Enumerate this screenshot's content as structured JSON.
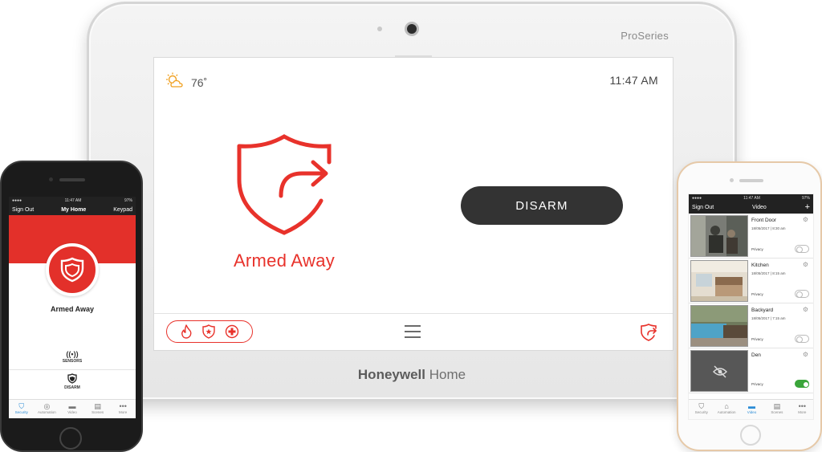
{
  "tablet": {
    "brand_model": "ProSeries",
    "brand_bold": "Honeywell",
    "brand_light": " Home",
    "weather": {
      "icon": "partly-cloudy-icon",
      "temp": "76˚"
    },
    "clock": "11:47 AM",
    "status_label": "Armed Away",
    "disarm_label": "DISARM",
    "emergency_icons": [
      "fire-icon",
      "police-badge-icon",
      "medical-cross-icon"
    ],
    "accent_color": "#e8322b",
    "button_color": "#333333"
  },
  "phone_left": {
    "status_time": "11:47 AM",
    "status_battery": "97%",
    "nav": {
      "left": "Sign Out",
      "title": "My Home",
      "right": "Keypad"
    },
    "status_label": "Armed Away",
    "sensors_label": "SENSORS",
    "disarm_label": "DISARM",
    "tabs": [
      {
        "label": "Security",
        "icon": "shield-icon",
        "active": true
      },
      {
        "label": "Automation",
        "icon": "automation-icon"
      },
      {
        "label": "Video",
        "icon": "video-icon"
      },
      {
        "label": "Scenes",
        "icon": "scenes-icon"
      },
      {
        "label": "More",
        "icon": "more-icon"
      }
    ]
  },
  "phone_right": {
    "status_time": "11:47 AM",
    "status_battery": "97%",
    "nav": {
      "left": "Sign Out",
      "title": "Video",
      "right": "+"
    },
    "cameras": [
      {
        "name": "Front Door",
        "date": "18/05/2017 | 8:30 am",
        "privacy_label": "Privacy",
        "privacy_on": false
      },
      {
        "name": "Kitchen",
        "date": "18/05/2017 | 8:15 am",
        "privacy_label": "Privacy",
        "privacy_on": false
      },
      {
        "name": "Backyard",
        "date": "18/05/2017 | 7:15 am",
        "privacy_label": "Privacy",
        "privacy_on": false
      },
      {
        "name": "Den",
        "date": "",
        "privacy_label": "Privacy",
        "privacy_on": true
      }
    ],
    "tabs": [
      {
        "label": "Security",
        "icon": "shield-icon"
      },
      {
        "label": "Automation",
        "icon": "automation-icon"
      },
      {
        "label": "Video",
        "icon": "video-icon",
        "active": true
      },
      {
        "label": "Scenes",
        "icon": "scenes-icon"
      },
      {
        "label": "More",
        "icon": "more-icon"
      }
    ]
  }
}
